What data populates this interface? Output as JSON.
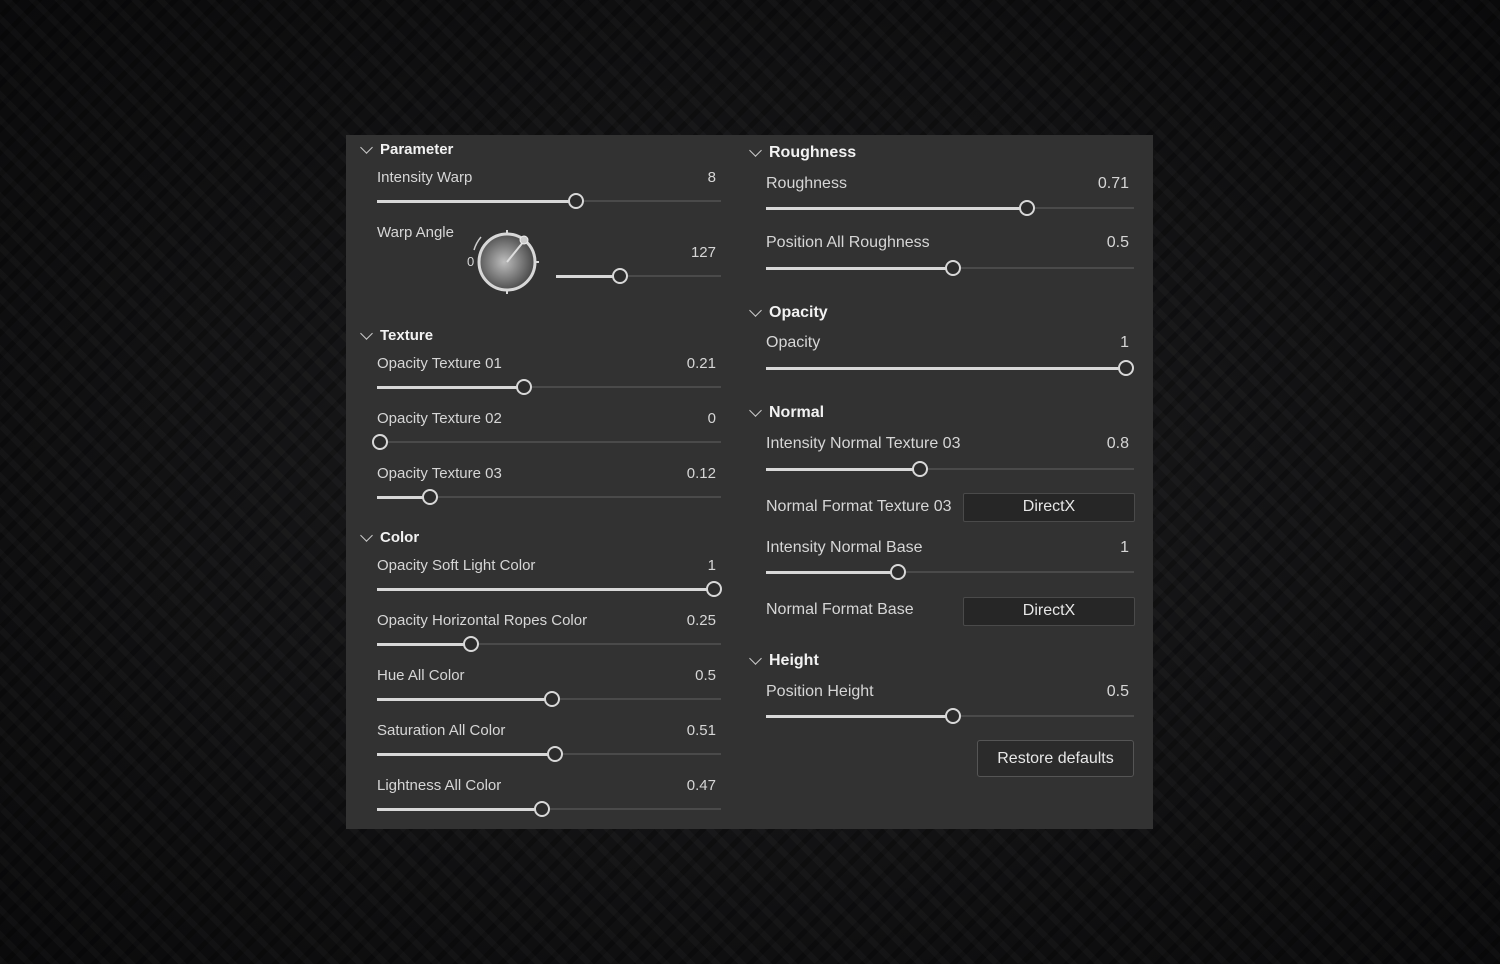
{
  "left": {
    "parameter": {
      "title": "Parameter",
      "intensity_warp": {
        "label": "Intensity Warp",
        "value": "8",
        "fill": 0.57
      },
      "warp_angle": {
        "label": "Warp Angle",
        "dial_zero": "0",
        "value": "127",
        "fill": 0.37,
        "angle_deg": 127
      }
    },
    "texture": {
      "title": "Texture",
      "sliders": [
        {
          "label": "Opacity Texture 01",
          "value": "0.21",
          "fill": 0.42
        },
        {
          "label": "Opacity Texture 02",
          "value": "0",
          "fill": 0.0
        },
        {
          "label": "Opacity Texture 03",
          "value": "0.12",
          "fill": 0.145
        }
      ]
    },
    "color": {
      "title": "Color",
      "sliders": [
        {
          "label": "Opacity  Soft Light Color",
          "value": "1",
          "fill": 0.97
        },
        {
          "label": "Opacity Horizontal Ropes Color",
          "value": "0.25",
          "fill": 0.265
        },
        {
          "label": "Hue All Color",
          "value": "0.5",
          "fill": 0.5
        },
        {
          "label": "Saturation All Color",
          "value": "0.51",
          "fill": 0.51
        },
        {
          "label": "Lightness All Color",
          "value": "0.47",
          "fill": 0.47
        }
      ]
    }
  },
  "right": {
    "roughness": {
      "title": "Roughness",
      "sliders": [
        {
          "label": "Roughness",
          "value": "0.71",
          "fill": 0.7
        },
        {
          "label": "Position All Roughness",
          "value": "0.5",
          "fill": 0.5
        }
      ]
    },
    "opacity": {
      "title": "Opacity",
      "sliders": [
        {
          "label": "Opacity",
          "value": "1",
          "fill": 0.97
        }
      ]
    },
    "normal": {
      "title": "Normal",
      "intensity_tex03": {
        "label": "Intensity Normal Texture 03",
        "value": "0.8",
        "fill": 0.41
      },
      "format_tex03": {
        "label": "Normal Format Texture 03",
        "selected": "DirectX"
      },
      "intensity_base": {
        "label": "Intensity Normal Base",
        "value": "1",
        "fill": 0.35
      },
      "format_base": {
        "label": "Normal Format Base",
        "selected": "DirectX"
      }
    },
    "height": {
      "title": "Height",
      "sliders": [
        {
          "label": "Position Height",
          "value": "0.5",
          "fill": 0.5
        }
      ]
    },
    "restore_label": "Restore defaults"
  }
}
